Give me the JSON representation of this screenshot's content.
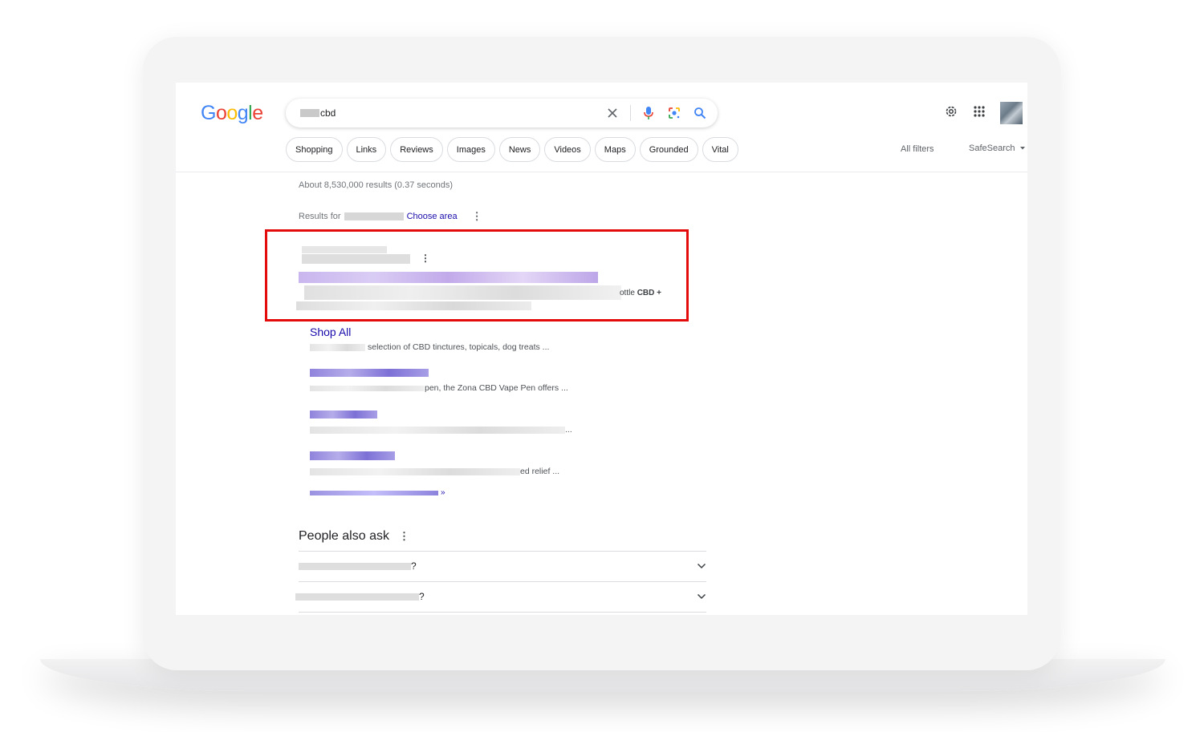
{
  "search": {
    "query": "cbd",
    "clear_label": "×"
  },
  "logo": [
    "G",
    "o",
    "o",
    "g",
    "l",
    "e"
  ],
  "chips": [
    "Shopping",
    "Links",
    "Reviews",
    "Images",
    "News",
    "Videos",
    "Maps",
    "Grounded",
    "Vital"
  ],
  "filters": {
    "all_filters": "All filters",
    "safesearch": "SafeSearch"
  },
  "results": {
    "stats": "About 8,530,000 results (0.37 seconds)",
    "results_for_label": "Results for",
    "choose_area": "Choose area",
    "ad_desc_tail_prefix": "ottle",
    "ad_desc_tail_bold": "CBD +"
  },
  "sitelinks": [
    {
      "title": "Shop All",
      "desc": "selection of CBD tinctures, topicals, dog treats ..."
    },
    {
      "title": "",
      "desc": "pen, the Zona CBD Vape Pen offers ..."
    },
    {
      "title": "",
      "desc": "..."
    },
    {
      "title": "",
      "desc": "ed relief ..."
    }
  ],
  "more_results_suffix": "»",
  "people_also_ask": {
    "title": "People also ask",
    "questions": [
      "?",
      "?"
    ]
  },
  "colors": {
    "link": "#1a0dab",
    "highlight_border": "#e30b0b",
    "google_blue": "#4285f4",
    "google_red": "#ea4335",
    "google_yellow": "#fbbc05",
    "google_green": "#34a853"
  }
}
